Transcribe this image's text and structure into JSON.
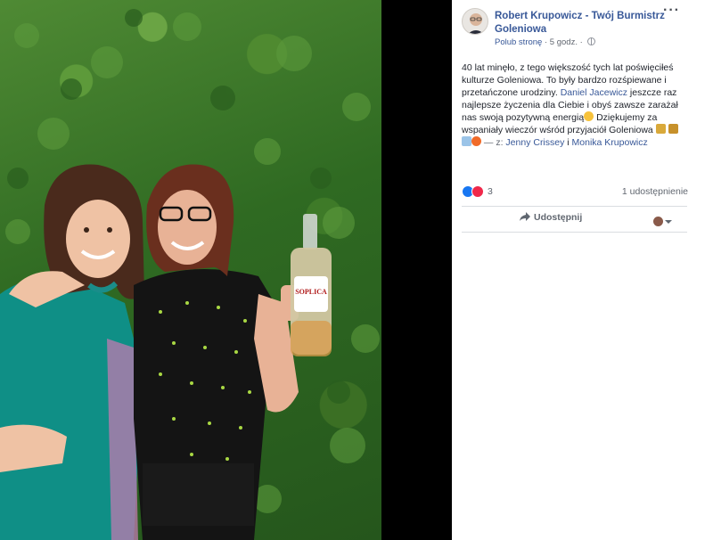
{
  "photo": {
    "bottle_label": "SOPLICA"
  },
  "post": {
    "author": "Robert Krupowicz - Twój Burmistrz Goleniowa",
    "like_page": "Polub stronę",
    "separator": "·",
    "time": "5 godz.",
    "separator2": "·",
    "more_icon": "···",
    "text": {
      "part1": "40 lat minęło, z tego większość tych lat poświęciłeś kulturze Goleniowa. To były bardzo rozśpiewane i przetańczone urodziny. ",
      "tag1": "Daniel Jacewicz",
      "part2": " jeszcze raz najlepsze życzenia dla Ciebie i obyś zawsze zarażał nas swoją pozytywną energią",
      "part3": " Dziękujemy za wspaniały wieczór wśród przyjaciół Goleniowa ",
      "with_prefix": " — z: ",
      "tag2": "Jenny Crissey",
      "and": " i ",
      "tag3": "Monika Krupowicz"
    },
    "reactions": {
      "count": "3"
    },
    "shares": "1 udostępnienie",
    "share_button": "Udostępnij"
  },
  "colors": {
    "link": "#385898",
    "like": "#1877f2",
    "love": "#f0284a",
    "ivy": "#3e7a28"
  },
  "icons": {
    "more": "ellipsis-icon",
    "globe": "globe-icon",
    "share": "share-arrow-icon",
    "like": "like-reaction-icon",
    "love": "love-reaction-icon"
  }
}
